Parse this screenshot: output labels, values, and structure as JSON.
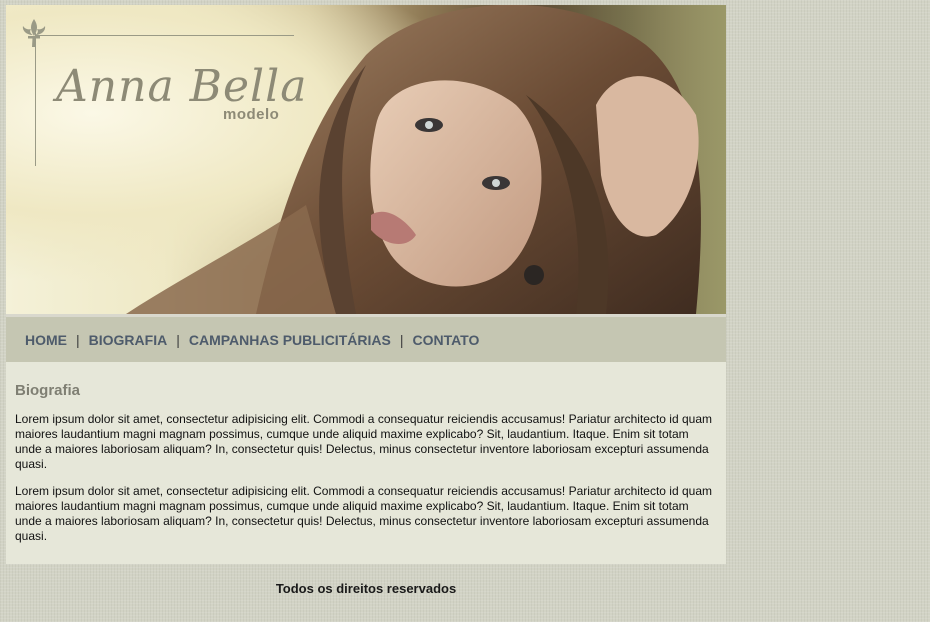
{
  "header": {
    "logo": {
      "name": "Anna Bella",
      "subtitle": "modelo"
    },
    "photo_icon": "portrait-photo"
  },
  "nav": {
    "items": [
      {
        "label": "HOME"
      },
      {
        "label": "BIOGRAFIA"
      },
      {
        "label": "CAMPANHAS PUBLICITÁRIAS"
      },
      {
        "label": "CONTATO"
      }
    ],
    "separator": "|"
  },
  "main": {
    "title": "Biografia",
    "paragraphs": [
      "Lorem ipsum dolor sit amet, consectetur adipisicing elit. Commodi a consequatur reiciendis accusamus! Pariatur architecto id quam maiores laudantium magni magnam possimus, cumque unde aliquid maxime explicabo? Sit, laudantium. Itaque. Enim sit totam unde a maiores laboriosam aliquam? In, consectetur quis! Delectus, minus consectetur inventore laboriosam excepturi assumenda quasi.",
      "Lorem ipsum dolor sit amet, consectetur adipisicing elit. Commodi a consequatur reiciendis accusamus! Pariatur architecto id quam maiores laudantium magni magnam possimus, cumque unde aliquid maxime explicabo? Sit, laudantium. Itaque. Enim sit totam unde a maiores laboriosam aliquam? In, consectetur quis! Delectus, minus consectetur inventore laboriosam excepturi assumenda quasi."
    ]
  },
  "footer": {
    "text": "Todos os direitos reservados"
  },
  "colors": {
    "page_bg": "#d2d3c5",
    "nav_bg": "#c5c6b2",
    "nav_text": "#4e5b6b",
    "content_bg": "#e6e7d9",
    "title_text": "#7f7f73"
  }
}
